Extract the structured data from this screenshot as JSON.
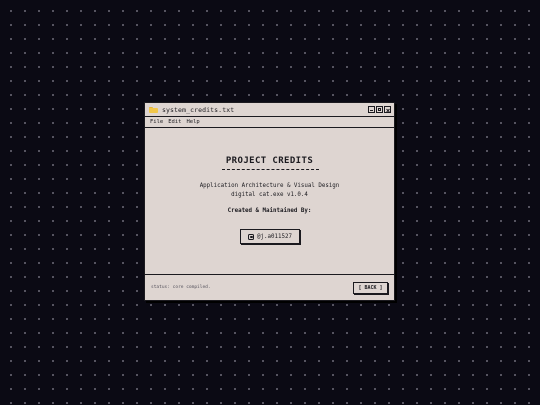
{
  "window": {
    "title": "system_credits.txt",
    "controls": {
      "minimize_icon": "minimize-icon",
      "maximize_icon": "maximize-icon",
      "close_icon": "close-icon"
    }
  },
  "menu": {
    "items": [
      "File",
      "Edit",
      "Help"
    ]
  },
  "content": {
    "heading": "PROJECT CREDITS",
    "line1": "Application Architecture & Visual Design",
    "line2": "digital cat.exe v1.0.4",
    "line3": "Created & Maintained By:",
    "handle_button": {
      "icon": "instagram-icon",
      "label": "@j.a011527"
    }
  },
  "footer": {
    "status": "status: core compiled.",
    "back_label": "[ BACK ]"
  },
  "colors": {
    "desktop_bg": "#0b0a14",
    "window_bg": "#ded5d1",
    "ink": "#1b1a1f",
    "folder": "#f2c74a"
  }
}
